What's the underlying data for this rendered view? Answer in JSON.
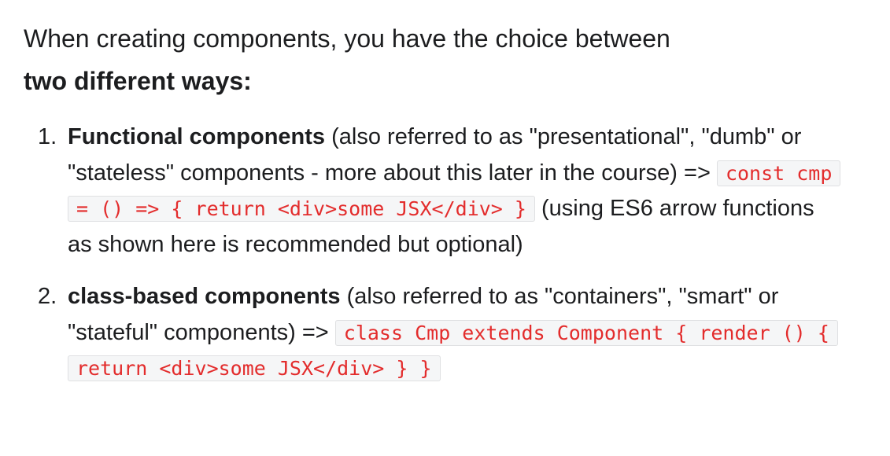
{
  "intro": {
    "text": "When creating components, you have the choice between",
    "emphasis": "two different ways:"
  },
  "items": [
    {
      "number": "1.",
      "term": "Functional components",
      "description": "(also referred to as \"presentational\", \"dumb\" or \"stateless\" components - more about this later in the course) =>",
      "code": "const cmp = () => { return <div>some JSX</div> }",
      "after": "(using ES6 arrow functions as shown here is recommended but optional)"
    },
    {
      "number": "2.",
      "term": "class-based components",
      "description": "(also referred to as \"containers\", \"smart\" or \"stateful\" components) =>",
      "code": "class Cmp extends Component { render () { return <div>some JSX</div> } }",
      "after": ""
    }
  ]
}
